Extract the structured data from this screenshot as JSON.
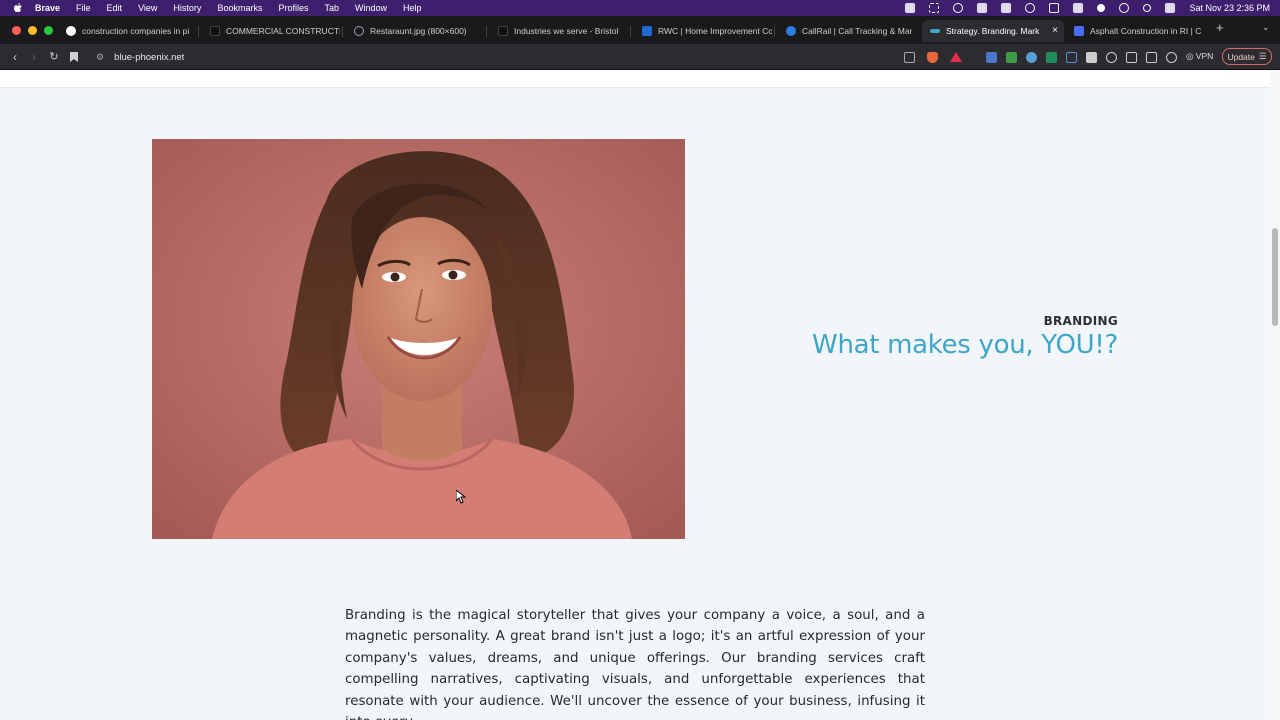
{
  "menubar": {
    "app": "Brave",
    "items": [
      "File",
      "Edit",
      "View",
      "History",
      "Bookmarks",
      "Profiles",
      "Tab",
      "Window",
      "Help"
    ],
    "clock": "Sat Nov 23  2:36 PM"
  },
  "tabs": [
    {
      "title": "construction companies in pi",
      "color": "#4285f4"
    },
    {
      "title": "COMMERCIAL CONSTRUCTI",
      "color": "#111111"
    },
    {
      "title": "Restaraunt.jpg (800×600)",
      "color": "#9aa0a6"
    },
    {
      "title": "Industries we serve - Bristol",
      "color": "#222222"
    },
    {
      "title": "RWC | Home Improvement Co",
      "color": "#1e6bd6"
    },
    {
      "title": "CallRail | Call Tracking & Mar",
      "color": "#2a7de1"
    },
    {
      "title": "Strategy. Branding. Mark",
      "color": "#3ea6c6"
    },
    {
      "title": "Asphalt Construction in RI | C",
      "color": "#4a6cf7"
    }
  ],
  "active_tab_index": 6,
  "address": {
    "url": "blue-phoenix.net"
  },
  "toolbar": {
    "vpn_label": "VPN",
    "update_label": "Update"
  },
  "hero": {
    "eyebrow": "BRANDING",
    "headline": "What makes you, YOU!?"
  },
  "body": {
    "paragraph": "Branding is the magical storyteller that gives your company a voice, a soul, and a magnetic personality. A great brand isn't just a logo; it's an artful expression of your company's values, dreams, and unique offerings. Our branding services craft compelling narratives, captivating visuals, and unforgettable experiences that resonate with your audience. We'll uncover the essence of your business, infusing it into every"
  },
  "colors": {
    "accent": "#3ea6c6",
    "menubar": "#3d1f6e",
    "page_bg": "#f2f6fb"
  }
}
